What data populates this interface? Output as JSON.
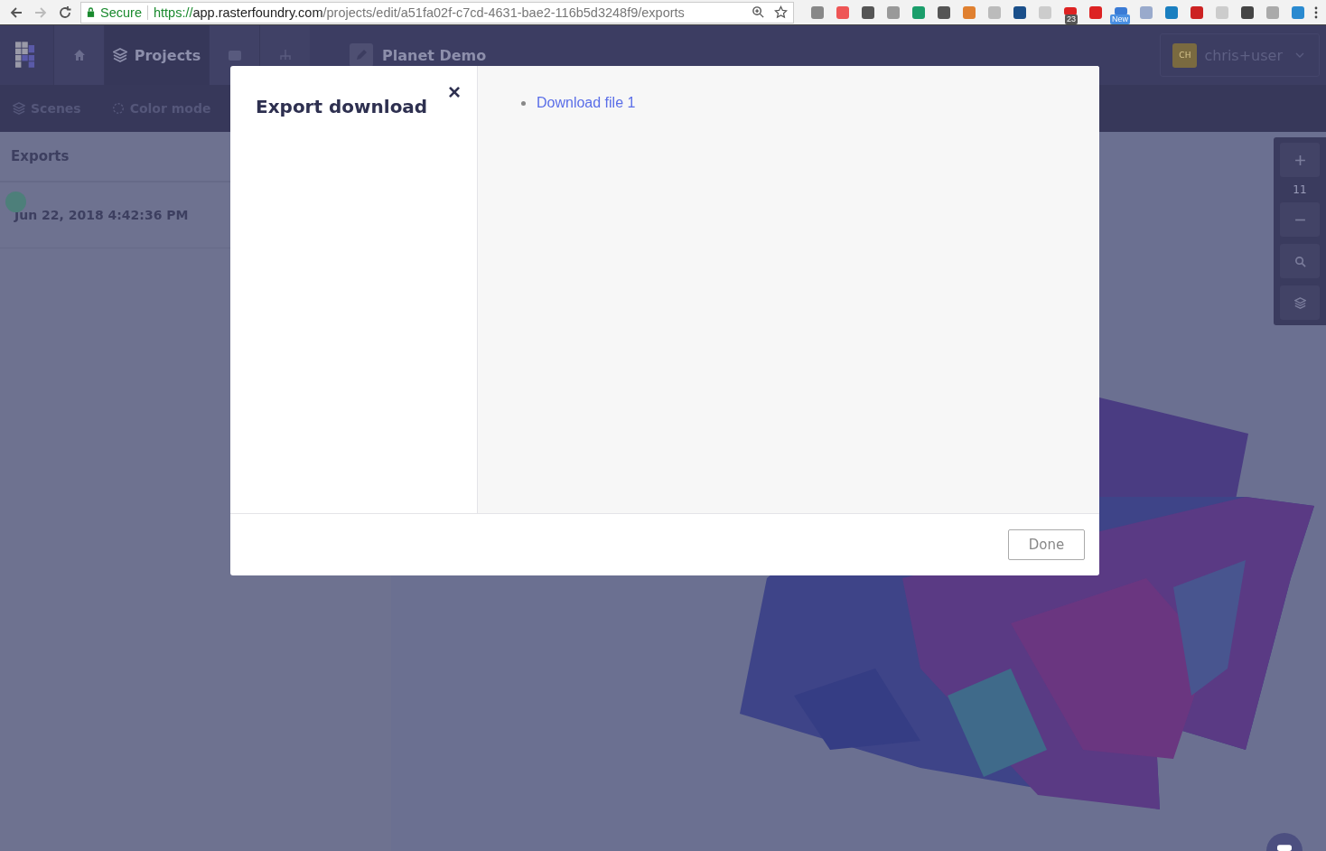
{
  "browser": {
    "secure_label": "Secure",
    "url_scheme": "https://",
    "url_host": "app.rasterfoundry.com",
    "url_path": "/projects/edit/a51fa02f-c7cd-4631-bae2-116b5d3248f9/exports",
    "extension_badges": [
      {
        "text": "23"
      },
      {
        "text": "New"
      }
    ]
  },
  "header": {
    "nav": [
      {
        "kind": "home",
        "selected": false
      },
      {
        "kind": "projects",
        "label": "Projects",
        "selected": true
      },
      {
        "kind": "imports",
        "selected": false
      },
      {
        "kind": "lab",
        "selected": false
      }
    ],
    "project_title": "Planet Demo",
    "user": {
      "initials": "CH",
      "name": "chris+user"
    }
  },
  "toolbar": [
    {
      "kind": "scenes",
      "label": "Scenes"
    },
    {
      "kind": "color",
      "label": "Color mode"
    }
  ],
  "sidebar": {
    "title": "Exports",
    "items": [
      {
        "date": "Jun 22, 2018 4:42:36 PM"
      }
    ]
  },
  "map_controls": {
    "zoom_level": "11"
  },
  "modal": {
    "title": "Export download",
    "close": "×",
    "links": [
      "Download file 1"
    ],
    "button": "Done"
  }
}
